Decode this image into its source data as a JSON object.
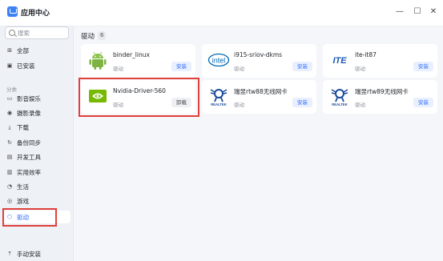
{
  "window": {
    "title": "应用中心",
    "minimize": "—",
    "maximize": "☐",
    "close": "✕"
  },
  "search": {
    "placeholder": "搜索"
  },
  "sidebar": {
    "top_items": [
      {
        "label": "全部",
        "icon": "grid-icon"
      },
      {
        "label": "已安装",
        "icon": "installed-icon"
      }
    ],
    "section": "分类",
    "items": [
      {
        "label": "影音娱乐",
        "icon": "play-icon"
      },
      {
        "label": "摄影录像",
        "icon": "camera-icon"
      },
      {
        "label": "下载",
        "icon": "download-icon"
      },
      {
        "label": "备份同步",
        "icon": "sync-icon"
      },
      {
        "label": "开发工具",
        "icon": "code-icon"
      },
      {
        "label": "实用效率",
        "icon": "tool-icon"
      },
      {
        "label": "生活",
        "icon": "life-icon"
      },
      {
        "label": "游戏",
        "icon": "game-icon"
      },
      {
        "label": "驱动",
        "icon": "driver-icon"
      }
    ],
    "bottom": {
      "label": "手动安装",
      "icon": "upload-icon"
    }
  },
  "main": {
    "heading": "驱动",
    "count": "6"
  },
  "cards": [
    {
      "name": "binder_linux",
      "category": "驱动",
      "button": "安装",
      "logo": "android-icon"
    },
    {
      "name": "i915-sriov-dkms",
      "category": "驱动",
      "button": "安装",
      "logo": "intel-logo"
    },
    {
      "name": "ite-it87",
      "category": "驱动",
      "button": "安装",
      "logo": "ite-logo"
    },
    {
      "name": "Nvidia-Driver-560",
      "category": "驱动",
      "button": "卸载",
      "logo": "nvidia-logo"
    },
    {
      "name": "瑞昱rtw88无线网卡",
      "category": "驱动",
      "button": "安装",
      "logo": "realtek-logo"
    },
    {
      "name": "瑞昱rtw89无线网卡",
      "category": "驱动",
      "button": "安装",
      "logo": "realtek-logo"
    }
  ],
  "colors": {
    "accent": "#2f6bff",
    "highlight": "#e0413b"
  }
}
